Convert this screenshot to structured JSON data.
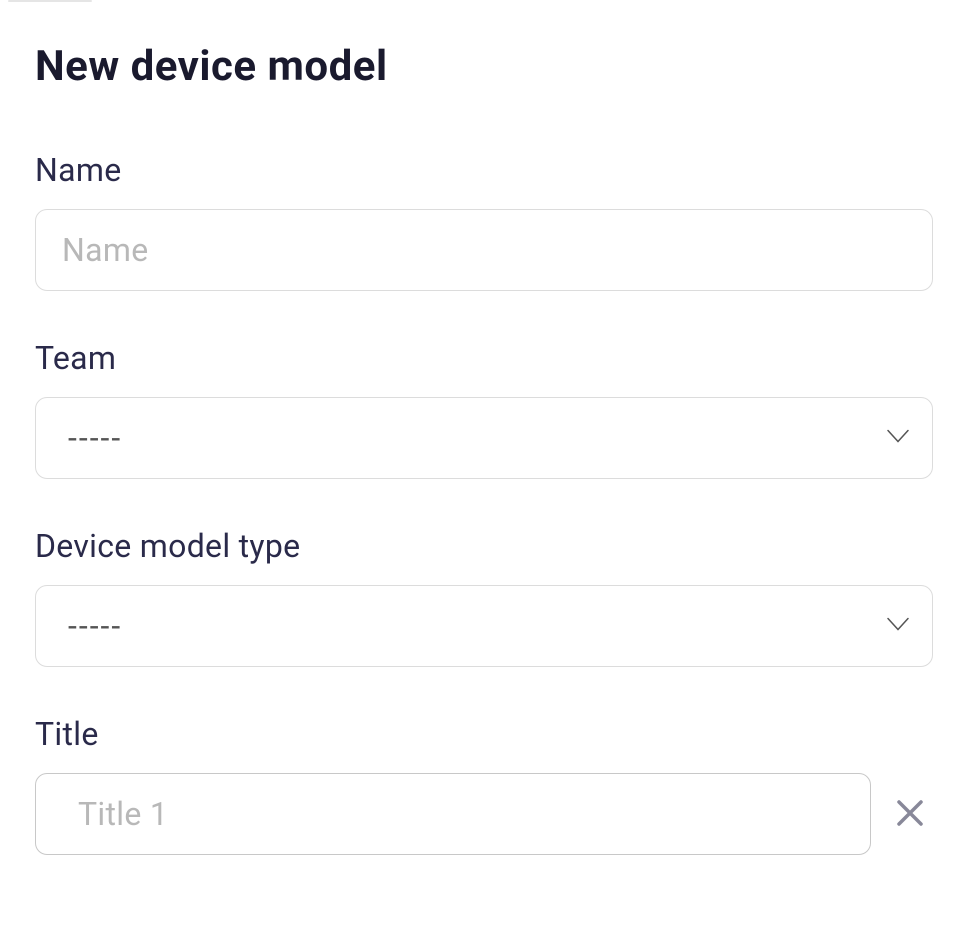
{
  "page": {
    "title": "New device model"
  },
  "form": {
    "name": {
      "label": "Name",
      "placeholder": "Name",
      "value": ""
    },
    "team": {
      "label": "Team",
      "selected": "-----"
    },
    "deviceModelType": {
      "label": "Device model type",
      "selected": "-----"
    },
    "title": {
      "label": "Title",
      "placeholder": "Title 1",
      "value": ""
    }
  }
}
